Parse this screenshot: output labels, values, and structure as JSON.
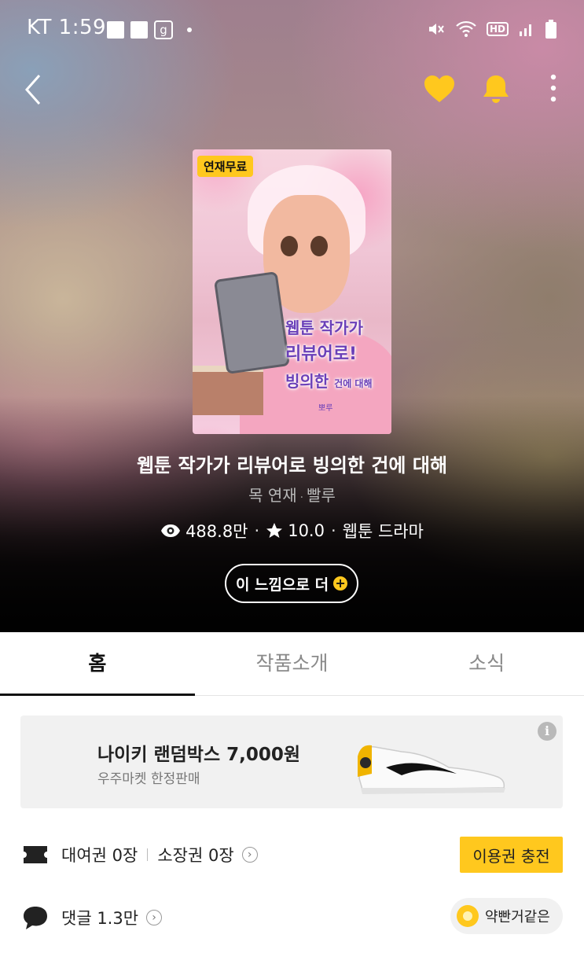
{
  "status_bar": {
    "carrier_time": "KT 1:59",
    "noti_g": "g",
    "hd": "HD"
  },
  "hero": {
    "cover": {
      "badge": "연재무료",
      "title_line1": "웹툰 작가가",
      "title_line2": "리뷰어로!",
      "title_line3": "빙의한",
      "title_small": "건에 대해",
      "credit": "뽀루"
    },
    "title": "웹툰 작가가 리뷰어로 빙의한 건에 대해",
    "schedule": "목 연재",
    "author": "빨루",
    "views": "488.8만",
    "rating": "10.0",
    "genre": "웹툰 드라마",
    "more_button": "이 느낌으로 더"
  },
  "tabs": [
    {
      "label": "홈",
      "active": true
    },
    {
      "label": "작품소개",
      "active": false
    },
    {
      "label": "소식",
      "active": false
    }
  ],
  "ad": {
    "title": "나이키 랜덤박스 7,000원",
    "subtitle": "우주마켓 한정판매",
    "info": "i"
  },
  "tickets": {
    "rental": "대여권 0장",
    "owned": "소장권 0장",
    "charge_button": "이용권 충전"
  },
  "comments": {
    "label": "댓글 1.3만",
    "user": "약빤거같은"
  },
  "colors": {
    "accent": "#ffc81e",
    "text": "#222222"
  }
}
